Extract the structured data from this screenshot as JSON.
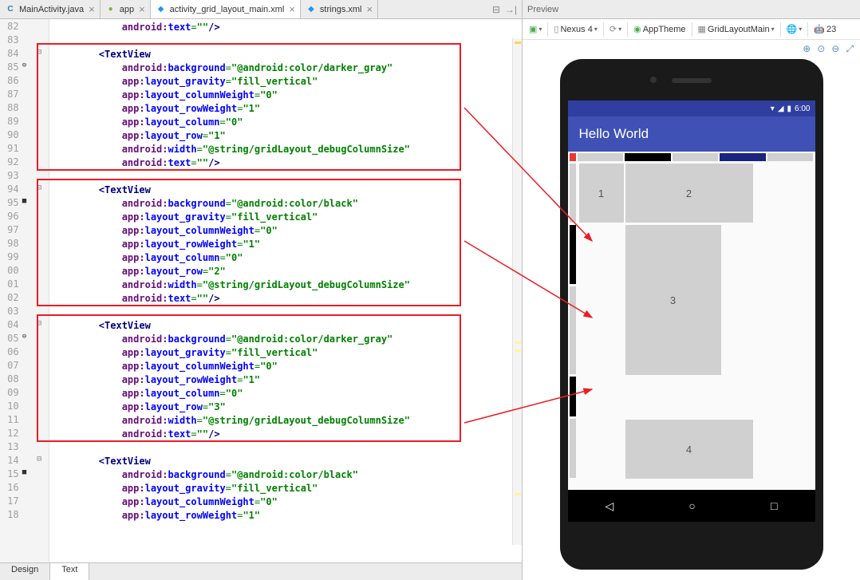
{
  "tabs": [
    {
      "label": "MainActivity.java",
      "icon": "C",
      "iconColor": "#3a7ab8"
    },
    {
      "label": "app",
      "icon": "●",
      "iconColor": "#7cb342"
    },
    {
      "label": "activity_grid_layout_main.xml",
      "icon": "◆",
      "iconColor": "#2196f3",
      "active": true
    },
    {
      "label": "strings.xml",
      "icon": "◆",
      "iconColor": "#2196f3"
    }
  ],
  "lineNumbers": [
    "82",
    "83",
    "84",
    "85",
    "86",
    "87",
    "88",
    "89",
    "90",
    "91",
    "92",
    "93",
    "94",
    "95",
    "96",
    "97",
    "98",
    "99",
    "00",
    "01",
    "02",
    "03",
    "04",
    "05",
    "06",
    "07",
    "08",
    "09",
    "10",
    "11",
    "12",
    "13",
    "14",
    "15",
    "16",
    "17",
    "18"
  ],
  "code": {
    "blocks": [
      {
        "attr": "android:text",
        "val": "\"\"",
        "suffix": "/>",
        "indent": 3
      },
      {
        "blank": true
      },
      {
        "tagOpen": "TextView",
        "indent": 2
      },
      {
        "attr": "android:background",
        "val": "\"@android:color/darker_gray\"",
        "indent": 3
      },
      {
        "attr": "app:layout_gravity",
        "val": "\"fill_vertical\"",
        "indent": 3
      },
      {
        "attr": "app:layout_columnWeight",
        "val": "\"0\"",
        "indent": 3
      },
      {
        "attr": "app:layout_rowWeight",
        "val": "\"1\"",
        "indent": 3
      },
      {
        "attr": "app:layout_column",
        "val": "\"0\"",
        "indent": 3
      },
      {
        "attr": "app:layout_row",
        "val": "\"1\"",
        "indent": 3
      },
      {
        "attr": "android:width",
        "val": "\"@string/gridLayout_debugColumnSize\"",
        "indent": 3
      },
      {
        "attr": "android:text",
        "val": "\"\"",
        "suffix": "/>",
        "indent": 3
      },
      {
        "blank": true
      },
      {
        "tagOpen": "TextView",
        "indent": 2
      },
      {
        "attr": "android:background",
        "val": "\"@android:color/black\"",
        "indent": 3
      },
      {
        "attr": "app:layout_gravity",
        "val": "\"fill_vertical\"",
        "indent": 3
      },
      {
        "attr": "app:layout_columnWeight",
        "val": "\"0\"",
        "indent": 3
      },
      {
        "attr": "app:layout_rowWeight",
        "val": "\"1\"",
        "indent": 3
      },
      {
        "attr": "app:layout_column",
        "val": "\"0\"",
        "indent": 3
      },
      {
        "attr": "app:layout_row",
        "val": "\"2\"",
        "indent": 3
      },
      {
        "attr": "android:width",
        "val": "\"@string/gridLayout_debugColumnSize\"",
        "indent": 3
      },
      {
        "attr": "android:text",
        "val": "\"\"",
        "suffix": "/>",
        "indent": 3
      },
      {
        "blank": true
      },
      {
        "tagOpen": "TextView",
        "indent": 2
      },
      {
        "attr": "android:background",
        "val": "\"@android:color/darker_gray\"",
        "indent": 3
      },
      {
        "attr": "app:layout_gravity",
        "val": "\"fill_vertical\"",
        "indent": 3
      },
      {
        "attr": "app:layout_columnWeight",
        "val": "\"0\"",
        "indent": 3
      },
      {
        "attr": "app:layout_rowWeight",
        "val": "\"1\"",
        "indent": 3
      },
      {
        "attr": "app:layout_column",
        "val": "\"0\"",
        "indent": 3
      },
      {
        "attr": "app:layout_row",
        "val": "\"3\"",
        "indent": 3
      },
      {
        "attr": "android:width",
        "val": "\"@string/gridLayout_debugColumnSize\"",
        "indent": 3
      },
      {
        "attr": "android:text",
        "val": "\"\"",
        "suffix": "/>",
        "indent": 3
      },
      {
        "blank": true
      },
      {
        "tagOpen": "TextView",
        "indent": 2
      },
      {
        "attr": "android:background",
        "val": "\"@android:color/black\"",
        "indent": 3
      },
      {
        "attr": "app:layout_gravity",
        "val": "\"fill_vertical\"",
        "indent": 3
      },
      {
        "attr": "app:layout_columnWeight",
        "val": "\"0\"",
        "indent": 3
      },
      {
        "attr": "app:layout_rowWeight",
        "val": "\"1\"",
        "indent": 3
      }
    ]
  },
  "bottomTabs": {
    "design": "Design",
    "text": "Text"
  },
  "preview": {
    "title": "Preview",
    "toolbar": {
      "device": "Nexus 4",
      "theme": "AppTheme",
      "layout": "GridLayoutMain",
      "api": "23"
    },
    "statusTime": "6:00",
    "appTitle": "Hello World",
    "cells": {
      "c1": "1",
      "c2": "2",
      "c3": "3",
      "c4": "4"
    }
  }
}
